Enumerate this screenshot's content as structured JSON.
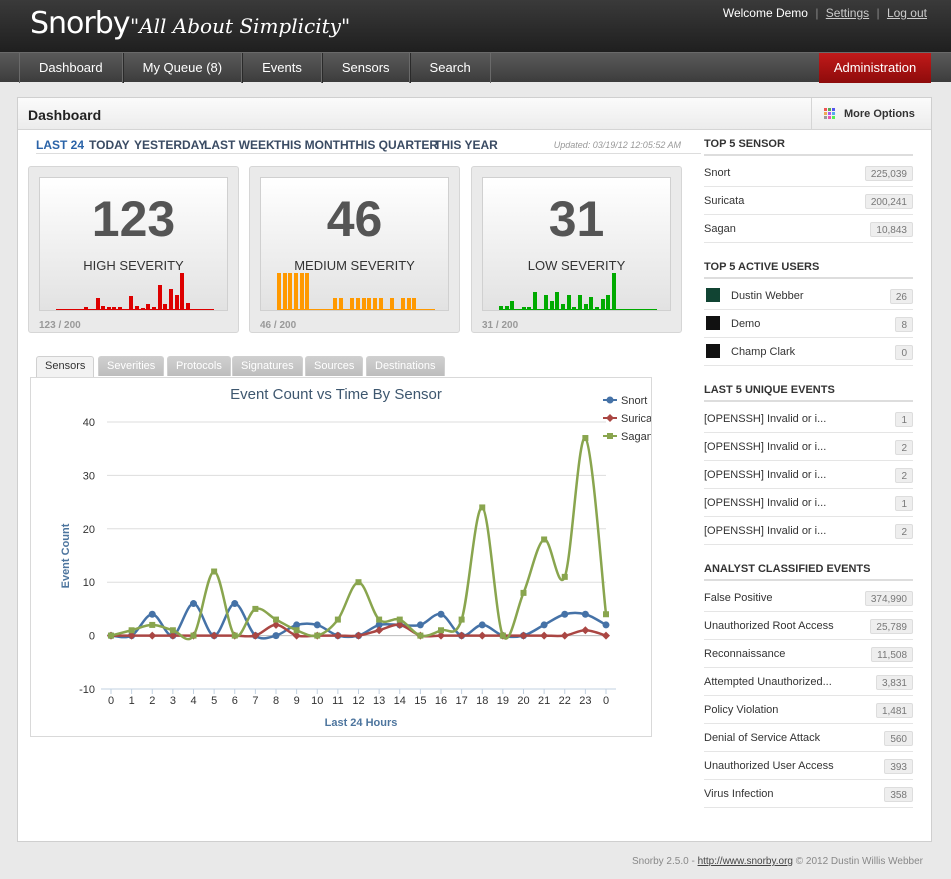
{
  "header": {
    "logo": "Snorby",
    "tagline": "\"All About Simplicity\"",
    "welcome": "Welcome Demo",
    "settings": "Settings",
    "logout": "Log out"
  },
  "nav": {
    "items": [
      "Dashboard",
      "My Queue (8)",
      "Events",
      "Sensors",
      "Search"
    ],
    "admin": "Administration"
  },
  "panel": {
    "title": "Dashboard",
    "more_options": "More Options"
  },
  "time_tabs": [
    "LAST 24",
    "TODAY",
    "YESTERDAY",
    "LAST WEEK",
    "THIS MONTH",
    "THIS QUARTER",
    "THIS YEAR"
  ],
  "updated": "Updated: 03/19/12 12:05:52 AM",
  "severity": [
    {
      "count": "123",
      "label": "HIGH SEVERITY",
      "foot": "123 / 200",
      "color": "#dd0000",
      "bars": [
        0,
        0,
        0,
        0,
        0,
        0.07,
        0,
        0.28,
        0.1,
        0.07,
        0.07,
        0.07,
        0,
        0.32,
        0.1,
        0.04,
        0.14,
        0.07,
        0.57,
        0.14,
        0.47,
        0.35,
        0.85,
        0.17,
        0,
        0,
        0,
        0
      ]
    },
    {
      "count": "46",
      "label": "MEDIUM SEVERITY",
      "foot": "46 / 200",
      "color": "#ff9900",
      "bars": [
        0.85,
        0.85,
        0.85,
        0.85,
        0.85,
        0.85,
        0,
        0,
        0,
        0,
        0.28,
        0.28,
        0,
        0.28,
        0.28,
        0.28,
        0.28,
        0.28,
        0.28,
        0,
        0.28,
        0,
        0.28,
        0.28,
        0.28,
        0,
        0,
        0
      ]
    },
    {
      "count": "31",
      "label": "LOW SEVERITY",
      "foot": "31 / 200",
      "color": "#00aa00",
      "bars": [
        0.1,
        0.1,
        0.21,
        0,
        0.07,
        0.07,
        0.42,
        0,
        0.35,
        0.2,
        0.4,
        0.14,
        0.35,
        0.07,
        0.35,
        0.14,
        0.3,
        0.07,
        0.24,
        0.35,
        0.85,
        0,
        0,
        0,
        0,
        0,
        0,
        0
      ]
    }
  ],
  "chart_tabs": [
    "Sensors",
    "Severities",
    "Protocols",
    "Signatures",
    "Sources",
    "Destinations"
  ],
  "chart_data": {
    "type": "line",
    "title": "Event Count vs Time By Sensor",
    "xlabel": "Last 24 Hours",
    "ylabel": "Event Count",
    "categories": [
      "0",
      "1",
      "2",
      "3",
      "4",
      "5",
      "6",
      "7",
      "8",
      "9",
      "10",
      "11",
      "12",
      "13",
      "14",
      "15",
      "16",
      "17",
      "18",
      "19",
      "20",
      "21",
      "22",
      "23",
      "0"
    ],
    "ylim": [
      -10,
      40
    ],
    "yticks": [
      "-10",
      "0",
      "10",
      "20",
      "30",
      "40"
    ],
    "legend_position": "top-right",
    "series": [
      {
        "name": "Snort",
        "color": "#4572a7",
        "values": [
          0,
          0,
          4,
          0,
          6,
          0,
          6,
          0,
          0,
          2,
          2,
          0,
          0,
          2,
          2,
          2,
          4,
          0,
          2,
          0,
          0,
          2,
          4,
          4,
          2
        ]
      },
      {
        "name": "Suricata",
        "color": "#aa4643",
        "values": [
          0,
          0,
          0,
          0,
          0,
          0,
          0,
          0,
          2,
          0,
          0,
          0,
          0,
          1,
          2,
          0,
          0,
          0,
          0,
          0,
          0,
          0,
          0,
          1,
          0
        ]
      },
      {
        "name": "Sagan",
        "color": "#89a54e",
        "values": [
          0,
          1,
          2,
          1,
          0,
          12,
          0,
          5,
          3,
          1,
          0,
          3,
          10,
          3,
          3,
          0,
          1,
          3,
          24,
          0,
          8,
          18,
          11,
          37,
          4
        ]
      }
    ]
  },
  "sidebar": {
    "top_sensor": {
      "title": "TOP 5 SENSOR",
      "rows": [
        {
          "name": "Snort",
          "count": "225,039"
        },
        {
          "name": "Suricata",
          "count": "200,241"
        },
        {
          "name": "Sagan",
          "count": "10,843"
        }
      ]
    },
    "top_users": {
      "title": "TOP 5 ACTIVE USERS",
      "rows": [
        {
          "name": "Dustin Webber",
          "count": "26"
        },
        {
          "name": "Demo",
          "count": "8"
        },
        {
          "name": "Champ Clark",
          "count": "0"
        }
      ]
    },
    "unique_events": {
      "title": "LAST 5 UNIQUE EVENTS",
      "rows": [
        {
          "name": "[OPENSSH] Invalid or i...",
          "count": "1"
        },
        {
          "name": "[OPENSSH] Invalid or i...",
          "count": "2"
        },
        {
          "name": "[OPENSSH] Invalid or i...",
          "count": "2"
        },
        {
          "name": "[OPENSSH] Invalid or i...",
          "count": "1"
        },
        {
          "name": "[OPENSSH] Invalid or i...",
          "count": "2"
        }
      ]
    },
    "classified": {
      "title": "ANALYST CLASSIFIED EVENTS",
      "rows": [
        {
          "name": "False Positive",
          "count": "374,990"
        },
        {
          "name": "Unauthorized Root Access",
          "count": "25,789"
        },
        {
          "name": "Reconnaissance",
          "count": "11,508"
        },
        {
          "name": "Attempted Unauthorized...",
          "count": "3,831"
        },
        {
          "name": "Policy Violation",
          "count": "1,481"
        },
        {
          "name": "Denial of Service Attack",
          "count": "560"
        },
        {
          "name": "Unauthorized User Access",
          "count": "393"
        },
        {
          "name": "Virus Infection",
          "count": "358"
        }
      ]
    }
  },
  "footer": {
    "version": "Snorby 2.5.0 -",
    "url": "http://www.snorby.org",
    "copyright": "© 2012 Dustin Willis Webber"
  }
}
